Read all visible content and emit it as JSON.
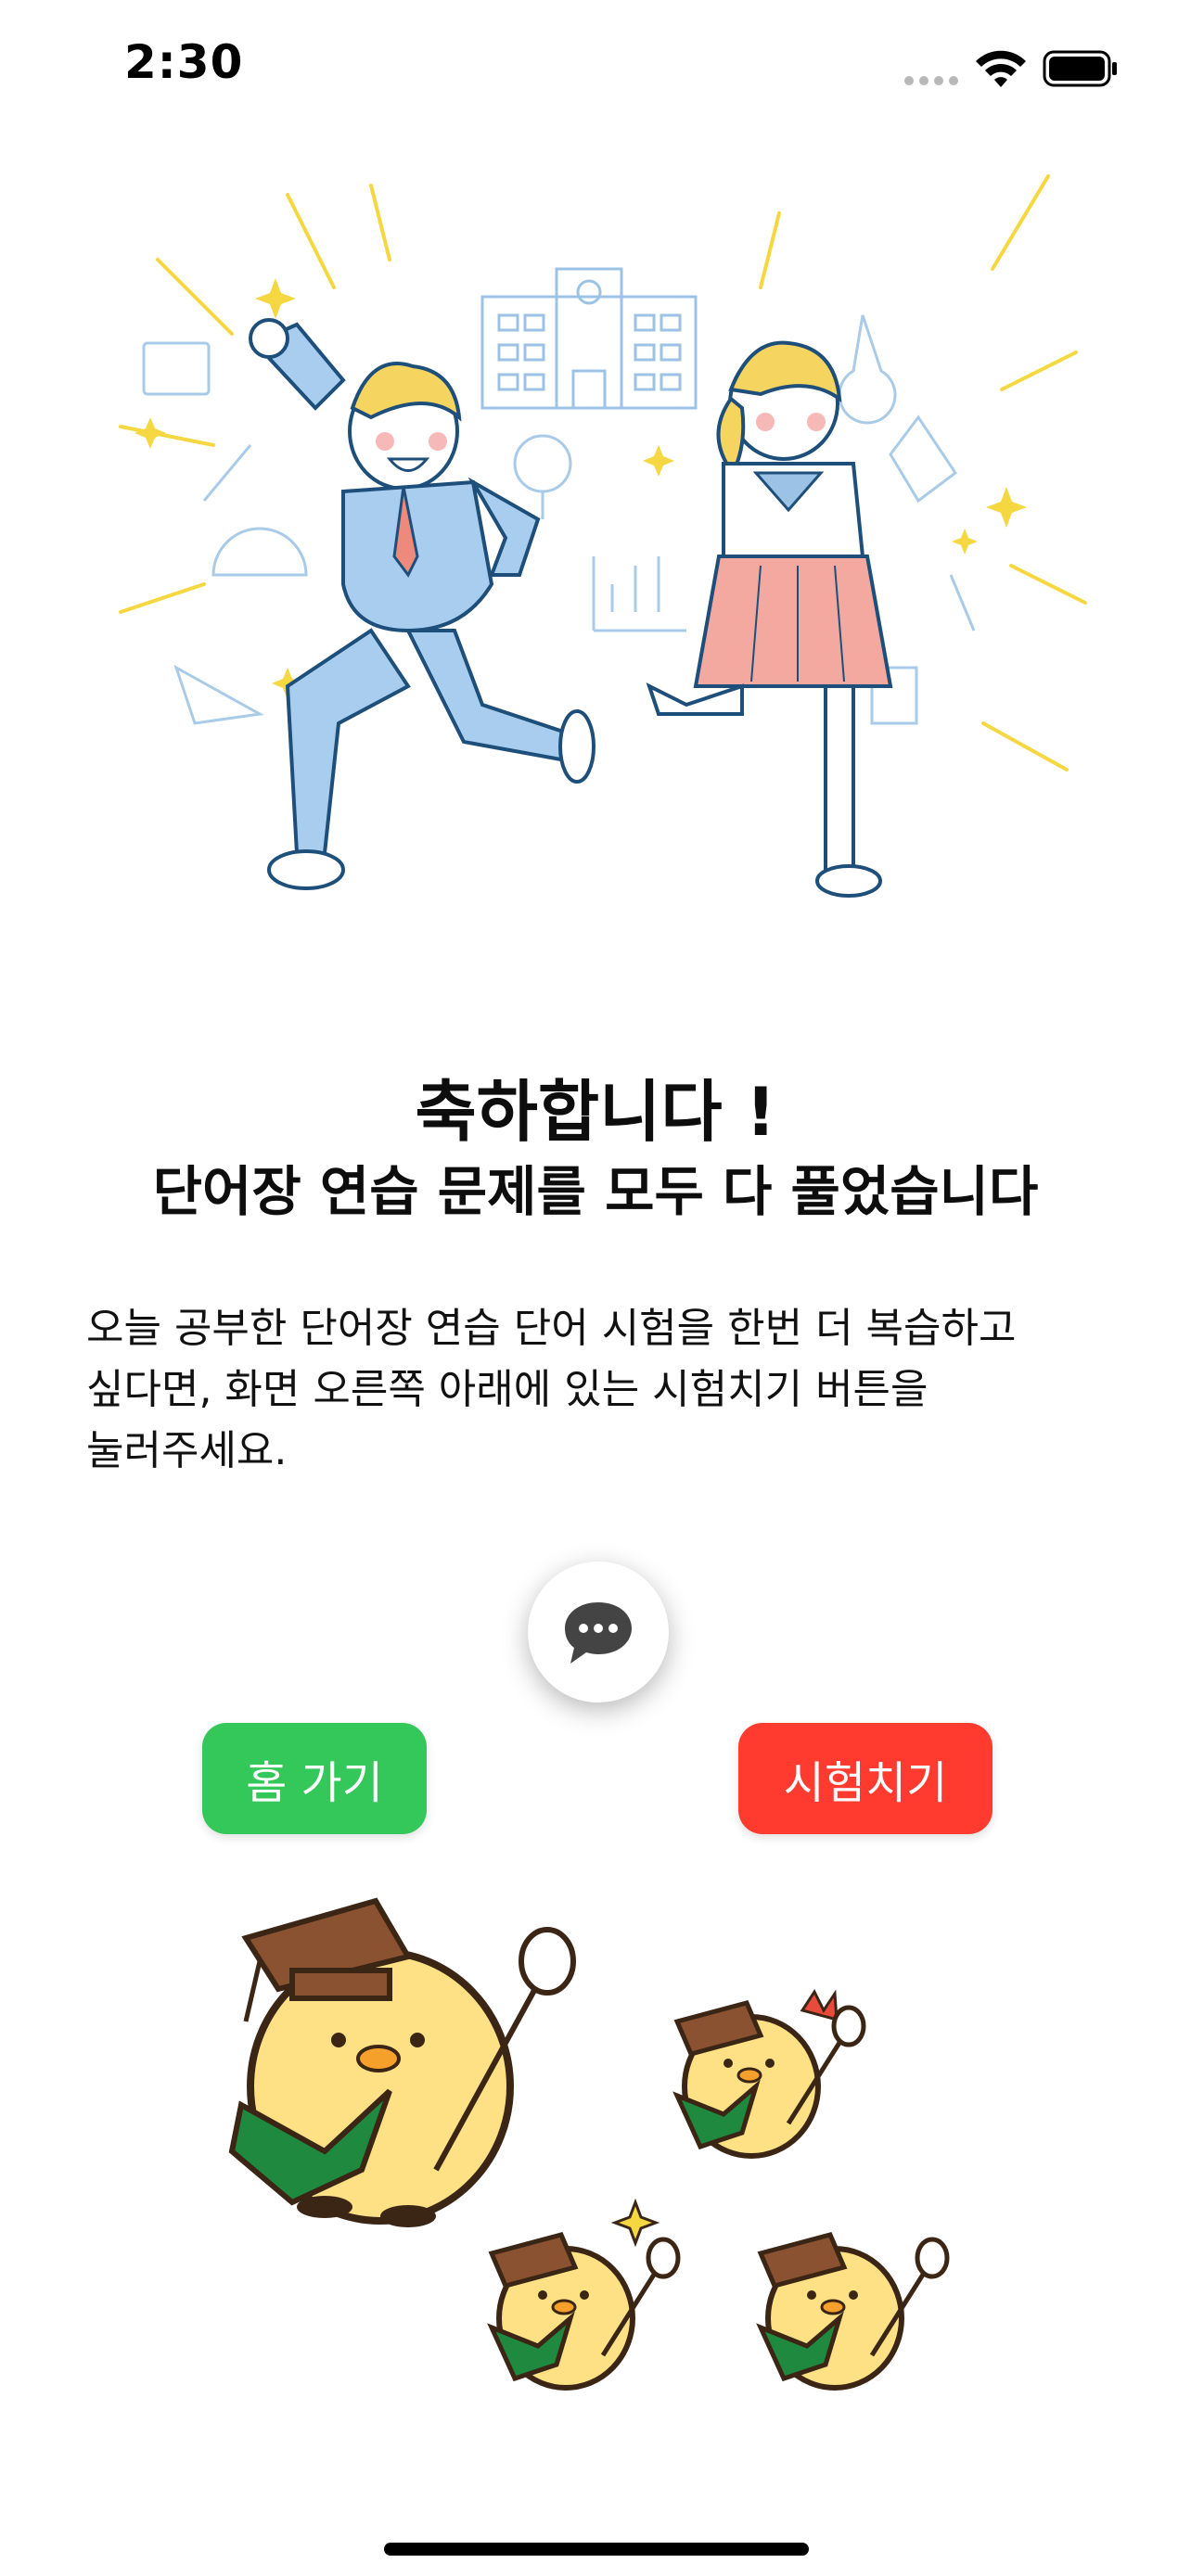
{
  "status_bar": {
    "time": "2:30"
  },
  "celebration": {
    "title": "축하합니다 !",
    "subtitle": "단어장 연습  문제를 모두 다 풀었습니다",
    "message": "오늘 공부한 단어장 연습  단어 시험을 한번 더 복습하고\n싶다면, 화면 오른쪽 아래에 있는 시험치기 버튼을\n눌러주세요."
  },
  "actions": {
    "home_label": "홈 가기",
    "test_label": "시험치기"
  },
  "icons": {
    "chat": "chat-bubble-icon",
    "wifi": "wifi-icon",
    "battery": "battery-icon",
    "signal": "signal-icon"
  },
  "colors": {
    "home_button": "#34c759",
    "test_button": "#ff3b30"
  }
}
